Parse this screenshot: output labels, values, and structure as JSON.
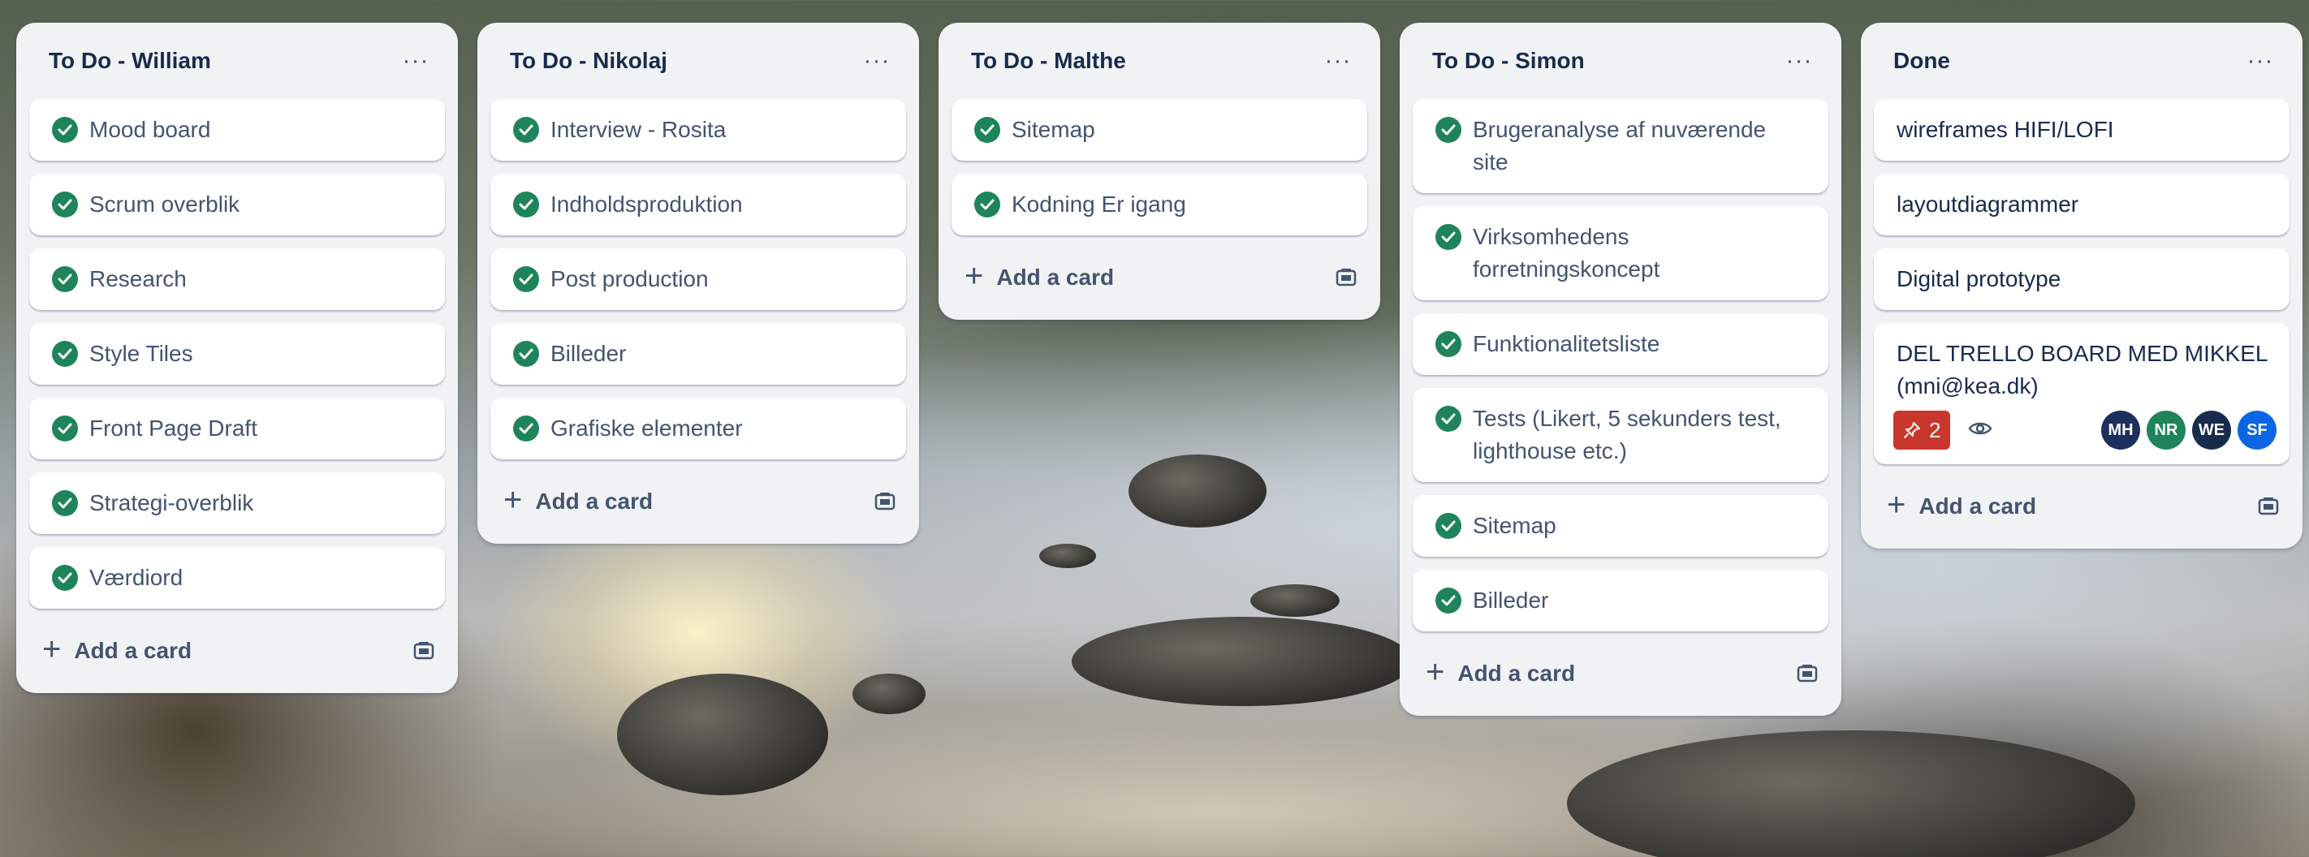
{
  "lists": [
    {
      "title": "To Do - William",
      "cards": [
        "Mood board",
        "Scrum overblik",
        "Research",
        "Style Tiles",
        "Front Page Draft",
        "Strategi-overblik",
        "Værdiord"
      ],
      "add_label": "Add a card"
    },
    {
      "title": "To Do - Nikolaj",
      "cards": [
        "Interview - Rosita",
        "Indholdsproduktion",
        "Post production",
        "Billeder",
        "Grafiske elementer"
      ],
      "add_label": "Add a card"
    },
    {
      "title": "To Do - Malthe",
      "cards": [
        "Sitemap",
        "Kodning Er igang"
      ],
      "add_label": "Add a card"
    },
    {
      "title": "To Do - Simon",
      "cards": [
        "Brugeranalyse af nuværende site",
        "Virksomhedens forretningskoncept",
        "Funktionalitetsliste",
        "Tests (Likert, 5 sekunders test, lighthouse etc.)",
        "Sitemap",
        "Billeder"
      ],
      "add_label": "Add a card"
    },
    {
      "title": "Done",
      "cards": [
        "wireframes HIFI/LOFI",
        "layoutdiagrammer",
        "Digital prototype",
        "DEL TRELLO BOARD MED MIKKEL (mni@kea.dk)"
      ],
      "badge_count": "2",
      "members": [
        "MH",
        "NR",
        "WE",
        "SF"
      ],
      "add_label": "Add a card"
    }
  ],
  "icons": {
    "menu": "ellipsis-icon",
    "check": "check-circle-icon",
    "add": "plus-icon",
    "template": "card-template-icon",
    "pin": "pin-icon",
    "watch": "eye-icon"
  },
  "colors": {
    "check": "#1f845a",
    "due_badge": "#c9372c",
    "avatar_mh": "#1d2f5e",
    "avatar_nr": "#1f845a",
    "avatar_we": "#172b4d",
    "avatar_sf": "#0c66e4"
  }
}
